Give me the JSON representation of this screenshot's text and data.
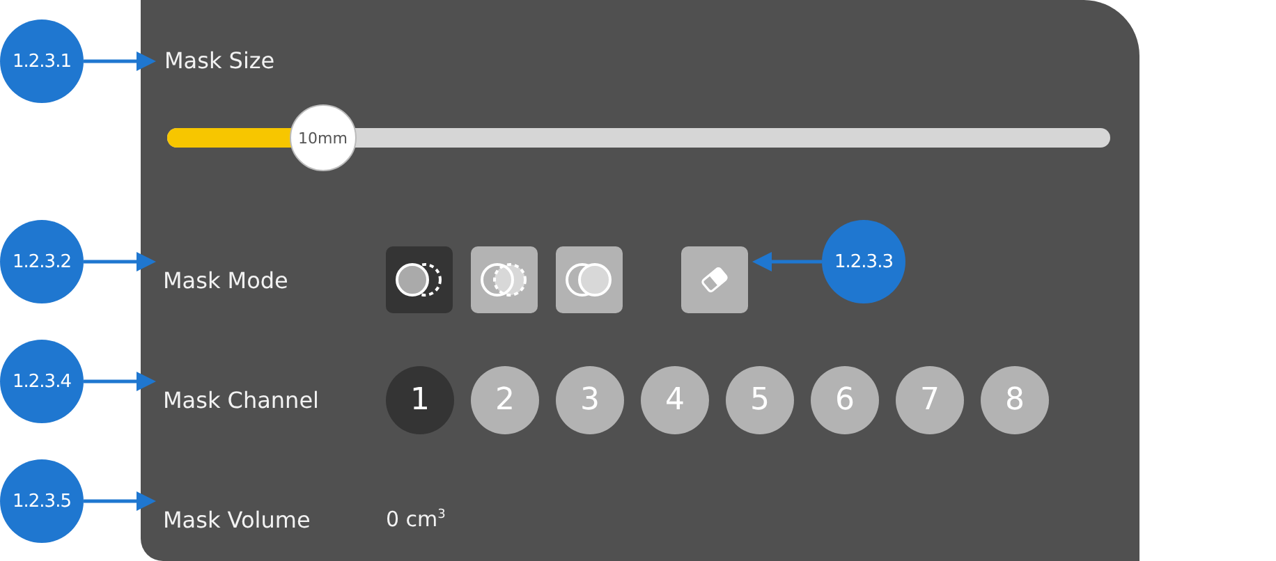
{
  "panel": {
    "mask_size": {
      "label": "Mask Size",
      "value": "10mm",
      "level": 0.165
    },
    "mask_mode": {
      "label": "Mask Mode",
      "modes": [
        {
          "kind": "subtract",
          "selected": true
        },
        {
          "kind": "add",
          "selected": false
        },
        {
          "kind": "merge",
          "selected": false
        }
      ],
      "eraser": {
        "selected": false
      }
    },
    "mask_channel": {
      "label": "Mask Channel",
      "channels": [
        {
          "label": "1",
          "selected": true
        },
        {
          "label": "2",
          "selected": false
        },
        {
          "label": "3",
          "selected": false
        },
        {
          "label": "4",
          "selected": false
        },
        {
          "label": "5",
          "selected": false
        },
        {
          "label": "6",
          "selected": false
        },
        {
          "label": "7",
          "selected": false
        },
        {
          "label": "8",
          "selected": false
        }
      ]
    },
    "mask_volume": {
      "label": "Mask Volume",
      "value": "0 cm$^{3}$"
    }
  },
  "callouts": [
    {
      "label": "1.2.3.1"
    },
    {
      "label": "1.2.3.2"
    },
    {
      "label": "1.2.3.3"
    },
    {
      "label": "1.2.3.4"
    },
    {
      "label": "1.2.3.5"
    }
  ]
}
